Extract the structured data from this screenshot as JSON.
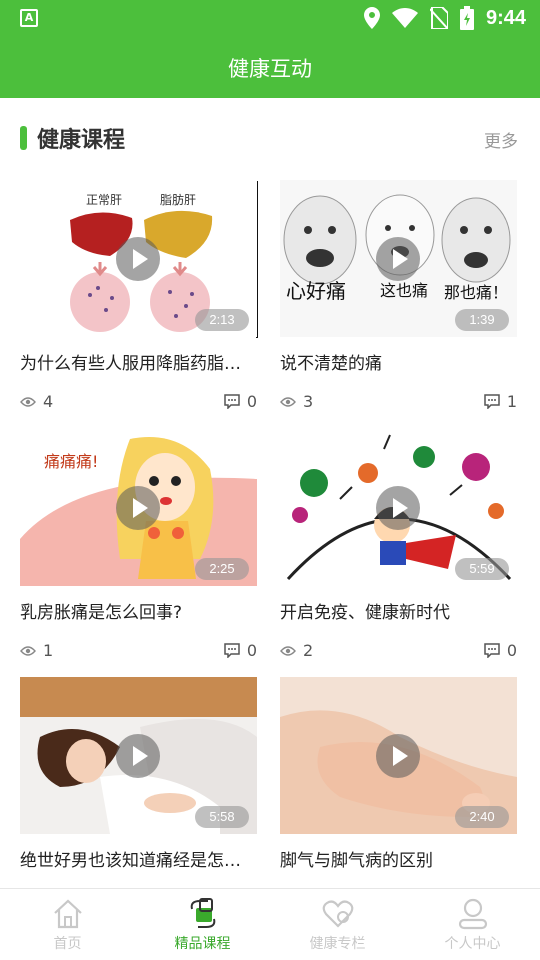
{
  "status": {
    "time": "9:44",
    "left_icon": "A"
  },
  "app": {
    "title": "健康互动"
  },
  "section": {
    "title": "健康课程",
    "more": "更多"
  },
  "courses": [
    {
      "title": "为什么有些人服用降脂药脂肪肝反而更严重",
      "duration": "2:13",
      "views": "4",
      "comments": "0",
      "image_text_1": "正常肝",
      "image_text_2": "脂肪肝"
    },
    {
      "title": "说不清楚的痛",
      "duration": "1:39",
      "views": "3",
      "comments": "1",
      "image_text_1": "心好痛",
      "image_text_2": "这也痛",
      "image_text_3": "那也痛！"
    },
    {
      "title": "乳房胀痛是怎么回事?",
      "duration": "2:25",
      "views": "1",
      "comments": "0",
      "image_text_1": "痛痛痛!"
    },
    {
      "title": "开启免疫、健康新时代",
      "duration": "5:59",
      "views": "2",
      "comments": "0"
    },
    {
      "title": "绝世好男也该知道痛经是怎么回事",
      "duration": "5:58"
    },
    {
      "title": "脚气与脚气病的区别",
      "duration": "2:40"
    }
  ],
  "tabs": [
    {
      "label": "首页",
      "icon": "home-icon"
    },
    {
      "label": "精品课程",
      "icon": "course-icon",
      "active": true
    },
    {
      "label": "健康专栏",
      "icon": "health-column-icon"
    },
    {
      "label": "个人中心",
      "icon": "profile-icon"
    }
  ],
  "colors": {
    "brand": "#4cbf3c",
    "active_tab": "#3aa92c",
    "inactive_tab": "#c8c8c8"
  }
}
